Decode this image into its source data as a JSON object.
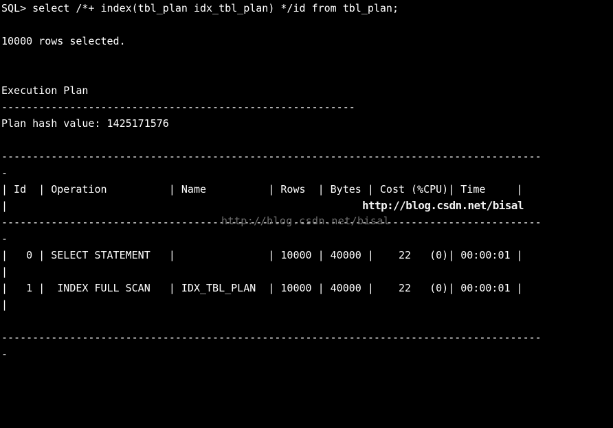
{
  "terminal": {
    "app": "SQL*Plus",
    "background_color": "#000000",
    "text_color": "#ffffff",
    "columns": 96,
    "prompt": "SQL>",
    "command": "select /*+ index(tbl_plan idx_tbl_plan) */id from tbl_plan;",
    "prompt_line": "SQL> select /*+ index(tbl_plan idx_tbl_plan) */id from tbl_plan;",
    "result_message": "10000 rows selected.",
    "plan_heading": "Execution Plan",
    "heading_rule": "---------------------------------------------------------",
    "plan_hash_label": "Plan hash value:",
    "plan_hash_value": "1425171576",
    "table_rule": "---------------------------------------------------------------------------------------",
    "table_rule_wrap": "-",
    "header_row": "| Id  | Operation          | Name          | Rows  | Bytes | Cost (%CPU)| Time     |",
    "header_wrap": "|",
    "columns_list": [
      "Id",
      "Operation",
      "Name",
      "Rows",
      "Bytes",
      "Cost (%CPU)",
      "Time"
    ],
    "rows": [
      {
        "id": "0",
        "operation": "SELECT STATEMENT",
        "name": "",
        "rows": "10000",
        "bytes": "40000",
        "cost": "22   (0)",
        "time": "00:00:01",
        "line": "|   0 | SELECT STATEMENT  |               | 10000 | 40000 |    22   (0)| 00:00:01 |",
        "wrap": "|"
      },
      {
        "id": "1",
        "operation": "INDEX FULL SCAN",
        "name": "IDX_TBL_PLAN",
        "rows": "10000",
        "bytes": "40000",
        "cost": "22   (0)",
        "time": "00:00:01",
        "line": "|   1 |  INDEX FULL SCAN  | IDX_TBL_PLAN  | 10000 | 40000 |    22   (0)| 00:00:01 |",
        "wrap": "|"
      }
    ],
    "screen_text": "SQL> select /*+ index(tbl_plan idx_tbl_plan) */id from tbl_plan;\n\n10000 rows selected.\n\n\nExecution Plan\n---------------------------------------------------------\nPlan hash value: 1425171576\n\n---------------------------------------------------------------------------------------\n-\n| Id  | Operation          | Name          | Rows  | Bytes | Cost (%CPU)| Time     |\n|\n---------------------------------------------------------------------------------------\n-\n|   0 | SELECT STATEMENT   |               | 10000 | 40000 |    22   (0)| 00:00:01 |\n|\n|   1 |  INDEX FULL SCAN   | IDX_TBL_PLAN  | 10000 | 40000 |    22   (0)| 00:00:01 |\n|\n\n---------------------------------------------------------------------------------------\n-"
  },
  "watermarks": {
    "bold_overlay": "http://blog.csdn.net/bisal",
    "faint_overlay": "http://blog.csdn.net/bisal",
    "bold_color": "#f2f2f2",
    "faint_color": "#6e6e6e"
  }
}
